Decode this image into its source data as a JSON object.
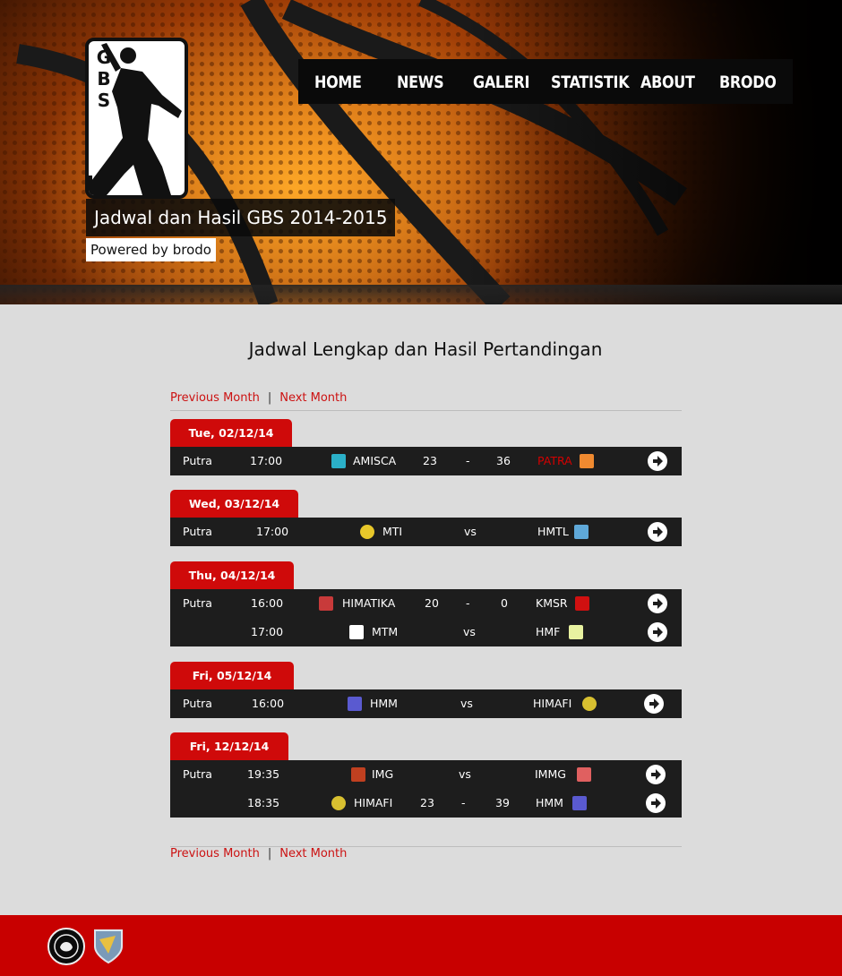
{
  "nav": {
    "items": [
      "HOME",
      "NEWS",
      "GALERI",
      "STATISTIK",
      "ABOUT",
      "BRODO"
    ]
  },
  "logo": {
    "letters": [
      "G",
      "B",
      "S"
    ]
  },
  "site": {
    "title": "Jadwal dan Hasil GBS 2014-2015",
    "subtitle": "Powered by brodo"
  },
  "main": {
    "title": "Jadwal Lengkap dan Hasil Pertandingan",
    "prev_month": "Previous Month",
    "separator": "|",
    "next_month": "Next Month"
  },
  "schedule": [
    {
      "date": "Tue, 02/12/14",
      "matches": [
        {
          "category": "Putra",
          "time": "17:00",
          "home": "AMISCA",
          "home_score": "23",
          "dash": "-",
          "away_score": "36",
          "away": "PATRA",
          "away_color": "#d40000",
          "home_logo_color": "#2bb0c8",
          "away_logo_color": "#f08a30"
        }
      ]
    },
    {
      "date": "Wed, 03/12/14",
      "matches": [
        {
          "category": "Putra",
          "time": "17:00",
          "home": "MTI",
          "vs": "vs",
          "away": "HMTL",
          "home_logo_color": "#e7c72a",
          "away_logo_color": "#5fa8d8"
        }
      ]
    },
    {
      "date": "Thu, 04/12/14",
      "matches": [
        {
          "category": "Putra",
          "time": "16:00",
          "home": "HIMATIKA",
          "home_score": "20",
          "dash": "-",
          "away_score": "0",
          "away": "KMSR",
          "home_logo_color": "#c83a3a",
          "away_logo_color": "#d01010"
        },
        {
          "category": "",
          "time": "17:00",
          "home": "MTM",
          "vs": "vs",
          "away": "HMF",
          "home_logo_color": "#ffffff",
          "away_logo_color": "#e8f2a0"
        }
      ]
    },
    {
      "date": "Fri, 05/12/14",
      "matches": [
        {
          "category": "Putra",
          "time": "16:00",
          "home": "HMM",
          "vs": "vs",
          "away": "HIMAFI",
          "home_logo_color": "#5a5ad0",
          "away_logo_color": "#d8c030"
        }
      ]
    },
    {
      "date": "Fri, 12/12/14",
      "matches": [
        {
          "category": "Putra",
          "time": "19:35",
          "home": "IMG",
          "vs": "vs",
          "away": "IMMG",
          "home_logo_color": "#c04020",
          "away_logo_color": "#e06060"
        },
        {
          "category": "",
          "time": "18:35",
          "home": "HIMAFI",
          "home_score": "23",
          "dash": "-",
          "away_score": "39",
          "away": "HMM",
          "home_logo_color": "#d8c030",
          "away_logo_color": "#5a5ad0"
        }
      ]
    }
  ],
  "colors": {
    "accent": "#cf0a0a",
    "row_bg": "#1d1d1d",
    "page_bg": "#dcdcdc"
  },
  "icons": {
    "row_action": "arrow-right-circle-icon"
  }
}
